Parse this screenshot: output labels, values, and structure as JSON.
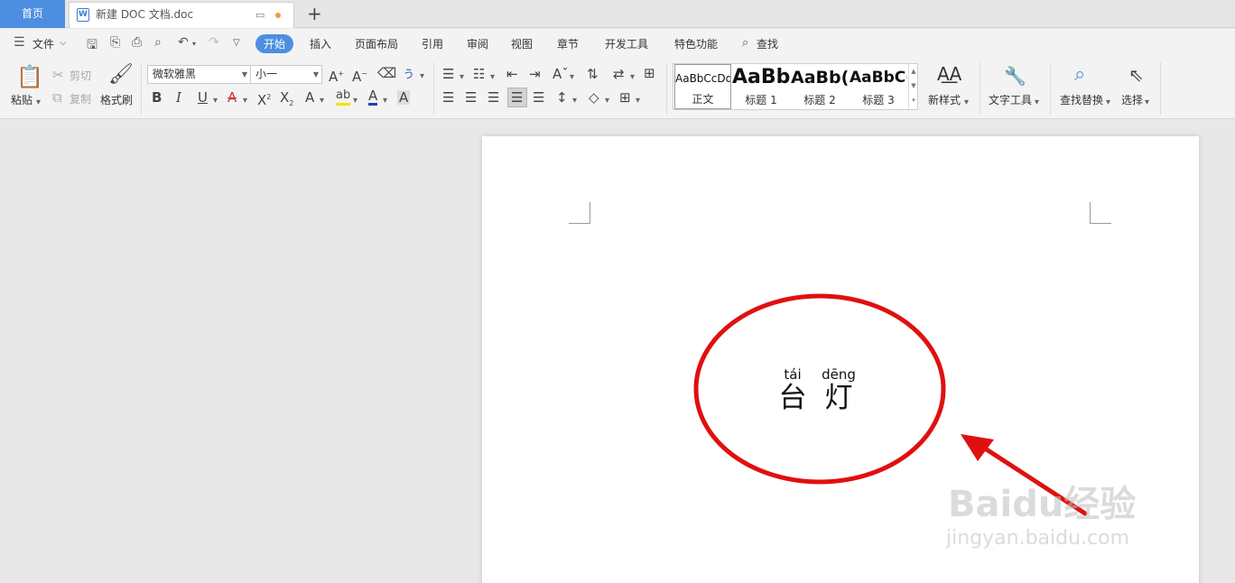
{
  "tabs": {
    "home": "首页",
    "doc_title": "新建 DOC 文档.doc",
    "doc_icon": "W",
    "monitor_icon": "▭",
    "new_tab_icon": "+"
  },
  "menu": {
    "file": "文件",
    "tabs": [
      "开始",
      "插入",
      "页面布局",
      "引用",
      "审阅",
      "视图",
      "章节",
      "开发工具",
      "特色功能"
    ],
    "search": "查找"
  },
  "ribbon": {
    "paste": "粘贴",
    "cut": "剪切",
    "copy": "复制",
    "format_painter": "格式刷",
    "font_name": "微软雅黑",
    "font_size": "小一",
    "styles": [
      {
        "sample": "AaBbCcDd",
        "label": "正文"
      },
      {
        "sample": "AaBb",
        "label": "标题 1"
      },
      {
        "sample": "AaBb(",
        "label": "标题 2"
      },
      {
        "sample": "AaBbC(",
        "label": "标题 3"
      }
    ],
    "new_style": "新样式",
    "text_tools": "文字工具",
    "find_replace": "查找替换",
    "select": "选择"
  },
  "document": {
    "pinyin_1": "tái",
    "char_1": "台",
    "pinyin_2": "dēng",
    "char_2": "灯"
  },
  "annotation": {
    "color": "#e01010"
  },
  "watermark": {
    "logo_text": "Baidu经验",
    "url_text": "jingyan.baidu.com"
  },
  "colors": {
    "accent": "#4d8ee0",
    "highlight_yellow": "#f5e200",
    "font_color_underline": "#1f3fbf"
  }
}
